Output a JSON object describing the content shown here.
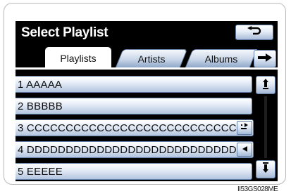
{
  "header": {
    "title": "Select Playlist",
    "back_icon": "return-arrow-icon"
  },
  "tabs": [
    {
      "label": "Playlists",
      "selected": true
    },
    {
      "label": "Artists",
      "selected": false
    },
    {
      "label": "Albums",
      "selected": false
    }
  ],
  "next_tab_icon": "right-arrow-icon",
  "list": {
    "items": [
      {
        "label": "1  AAAAA"
      },
      {
        "label": "2  BBBBB"
      },
      {
        "label": "3  CCCCCCCCCCCCCCCCCCCCCCCCCCCC"
      },
      {
        "label": "4  DDDDDDDDDDDDDDDDDDDDDDDDDDDD"
      },
      {
        "label": "5  EEEEE"
      }
    ]
  },
  "row_icons": {
    "expand_icon": "expand-text-icon",
    "collapse_icon": "left-triangle-icon"
  },
  "scroll": {
    "up_icon": "scroll-up-icon",
    "down_icon": "scroll-down-icon"
  },
  "caption": "II53GS028ME",
  "colors": {
    "screen_bg": "#000000",
    "button_gradient_top": "#ffffff",
    "button_gradient_bottom": "#a9bcd8",
    "button_border": "#5f7ca4"
  }
}
